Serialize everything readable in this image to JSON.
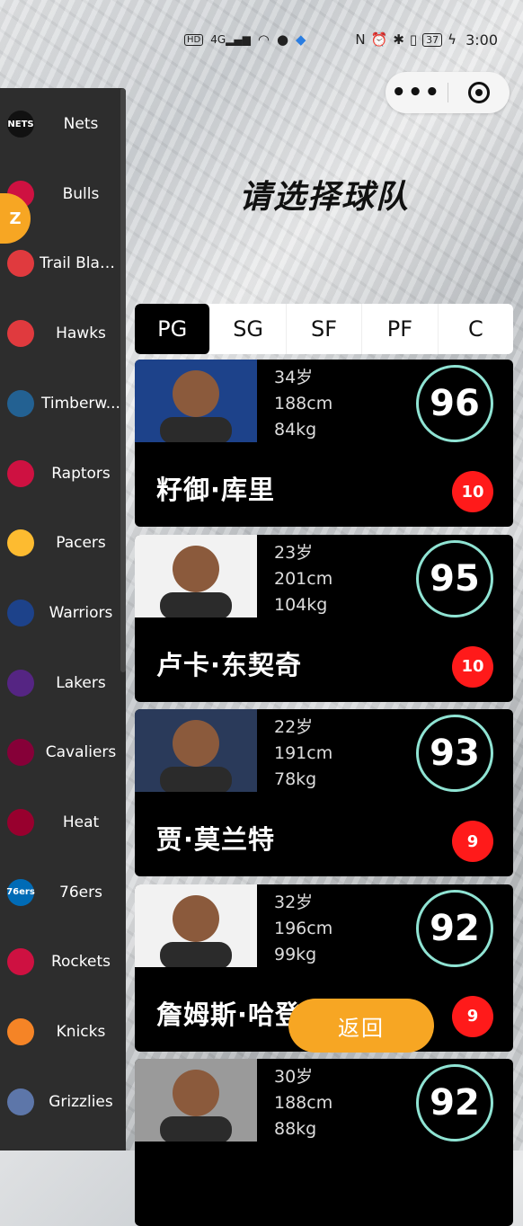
{
  "statusbar": {
    "left_chips": [
      "HD",
      "4G"
    ],
    "battery": "37",
    "time": "3:00"
  },
  "capsule": {
    "more": "•••"
  },
  "page_title": "请选择球队",
  "side_badge": "Z",
  "teams": [
    {
      "name": "Nets",
      "logo_text": "NETS",
      "color": "#111111"
    },
    {
      "name": "Bulls",
      "logo_text": "",
      "color": "#ce1141"
    },
    {
      "name": "Trail Blazers",
      "logo_text": "",
      "color": "#e03a3e"
    },
    {
      "name": "Hawks",
      "logo_text": "",
      "color": "#e03a3e"
    },
    {
      "name": "Timberw...",
      "logo_text": "",
      "color": "#236192"
    },
    {
      "name": "Raptors",
      "logo_text": "",
      "color": "#ce1141"
    },
    {
      "name": "Pacers",
      "logo_text": "",
      "color": "#fdbb30"
    },
    {
      "name": "Warriors",
      "logo_text": "",
      "color": "#1d428a"
    },
    {
      "name": "Lakers",
      "logo_text": "",
      "color": "#552583"
    },
    {
      "name": "Cavaliers",
      "logo_text": "",
      "color": "#860038"
    },
    {
      "name": "Heat",
      "logo_text": "",
      "color": "#98002e"
    },
    {
      "name": "76ers",
      "logo_text": "76ers",
      "color": "#006bb6"
    },
    {
      "name": "Rockets",
      "logo_text": "",
      "color": "#ce1141"
    },
    {
      "name": "Knicks",
      "logo_text": "",
      "color": "#f58426"
    },
    {
      "name": "Grizzlies",
      "logo_text": "",
      "color": "#5d76a9"
    }
  ],
  "tabs": [
    "PG",
    "SG",
    "SF",
    "PF",
    "C"
  ],
  "active_tab": "PG",
  "players": [
    {
      "age": "34岁",
      "height": "188cm",
      "weight": "84kg",
      "rating": "96",
      "name": "籽御·库里",
      "badge": "10",
      "photo_bg": "#1d428a"
    },
    {
      "age": "23岁",
      "height": "201cm",
      "weight": "104kg",
      "rating": "95",
      "name": "卢卡·东契奇",
      "badge": "10",
      "photo_bg": "#f2f2f2"
    },
    {
      "age": "22岁",
      "height": "191cm",
      "weight": "78kg",
      "rating": "93",
      "name": "贾·莫兰特",
      "badge": "9",
      "photo_bg": "#2a3a5a"
    },
    {
      "age": "32岁",
      "height": "196cm",
      "weight": "99kg",
      "rating": "92",
      "name": "詹姆斯·哈登",
      "badge": "9",
      "photo_bg": "#f2f2f2"
    },
    {
      "age": "30岁",
      "height": "188cm",
      "weight": "88kg",
      "rating": "92",
      "name": "",
      "badge": "",
      "photo_bg": "#9a9a9a"
    }
  ],
  "return_label": "返回",
  "colors": {
    "accent": "#f7a623",
    "rating_ring": "#8fe3d3",
    "badge": "#ff1a1a",
    "sidebar": "#2d2d2d"
  }
}
